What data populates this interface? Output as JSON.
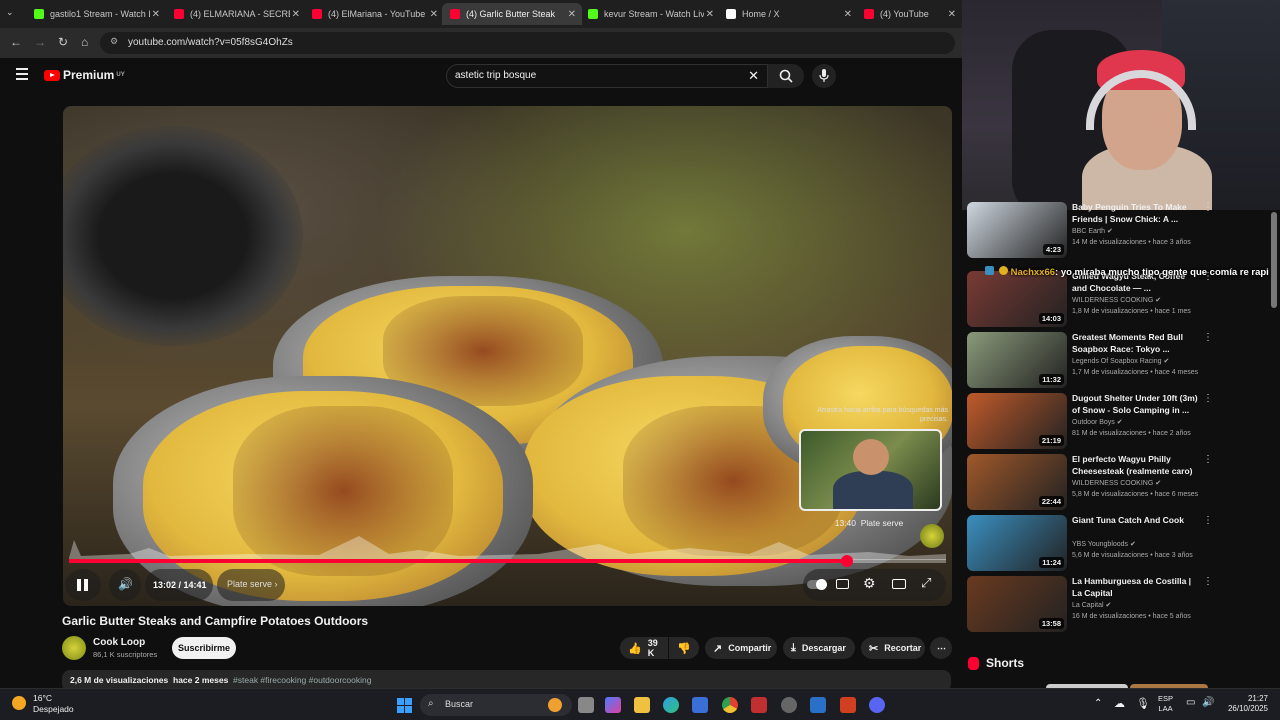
{
  "tabs": [
    {
      "label": "gastilo1 Stream - Watch L",
      "color": "#53fc18"
    },
    {
      "label": "(4) ELMARIANA - SECRET",
      "color": "#ff0033"
    },
    {
      "label": "(4) ElMariana - YouTube",
      "color": "#ff0033"
    },
    {
      "label": "(4) Garlic Butter Steak",
      "color": "#ff0033"
    },
    {
      "label": "kevur Stream - Watch Live",
      "color": "#53fc18"
    },
    {
      "label": "Home / X",
      "color": "#ffffff"
    },
    {
      "label": "(4) YouTube",
      "color": "#ff0033"
    }
  ],
  "address": {
    "url": "youtube.com/watch?v=05f8sG4OhZs"
  },
  "header": {
    "brand": "Premium",
    "brand_region": "UY",
    "search_value": "astetic trip bosque"
  },
  "player": {
    "pip_hint": "Arrastra hacia arriba para búsquedas más precisas.",
    "preview_time": "13:40",
    "preview_chapter": "Plate serve",
    "time": "13:02 / 14:41",
    "chapter": "Plate serve",
    "progress_fraction": 0.887
  },
  "video": {
    "title": "Garlic Butter Steaks and Campfire Potatoes Outdoors",
    "channel": "Cook Loop",
    "subs": "86,1 K suscriptores",
    "subscribe": "Suscribirme",
    "likes": "39 K",
    "share": "Compartir",
    "download": "Descargar",
    "clip": "Recortar",
    "desc_views": "2,6 M de visualizaciones",
    "desc_date": "hace 2 meses",
    "desc_tags": "#steak #firecooking #outdoorcooking"
  },
  "chat": {
    "user": "Nachxx66",
    "message": ": yo miraba mucho tipo gente que comía re rapi"
  },
  "recommendations": [
    {
      "title": "Baby Penguin Tries To Make Friends | Snow Chick: A ...",
      "channel": "BBC Earth",
      "views": "14 M de visualizaciones • hace 3 años",
      "duration": "4:23",
      "color": "#cfd7e0"
    },
    {
      "title": "Grilled Wagyu Steak, Coffee and Chocolate — ...",
      "channel": "WILDERNESS COOKING",
      "views": "1,8 M de visualizaciones • hace 1 mes",
      "duration": "14:03",
      "color": "#7a3a34"
    },
    {
      "title": "Greatest Moments Red Bull Soapbox Race: Tokyo ...",
      "channel": "Legends Of Soapbox Racing",
      "views": "1,7 M de visualizaciones • hace 4 meses",
      "duration": "11:32",
      "color": "#8a9a7a"
    },
    {
      "title": "Dugout Shelter Under 10ft (3m) of Snow - Solo Camping in ...",
      "channel": "Outdoor Boys",
      "views": "81 M de visualizaciones • hace 2 años",
      "duration": "21:19",
      "color": "#c05a2a"
    },
    {
      "title": "El perfecto Wagyu Philly Cheesesteak (realmente caro)",
      "channel": "WILDERNESS COOKING",
      "views": "5,8 M de visualizaciones • hace 6 meses",
      "duration": "22:44",
      "color": "#a0582a"
    },
    {
      "title": "Giant Tuna Catch And Cook",
      "channel": "YBS Youngbloods",
      "views": "5,6 M de visualizaciones • hace 3 años",
      "duration": "11:24",
      "color": "#3a8fc0"
    },
    {
      "title": "La Hamburguesa de Costilla | La Capital",
      "channel": "La Capital",
      "views": "16 M de visualizaciones • hace 5 años",
      "duration": "13:58",
      "color": "#6a3a20"
    }
  ],
  "shorts_label": "Shorts",
  "taskbar": {
    "temp": "16°C",
    "weather": "Despejado",
    "search": "Buscar",
    "lang": "ESP",
    "region": "LAA",
    "time": "21:27",
    "date": "26/10/2025"
  }
}
